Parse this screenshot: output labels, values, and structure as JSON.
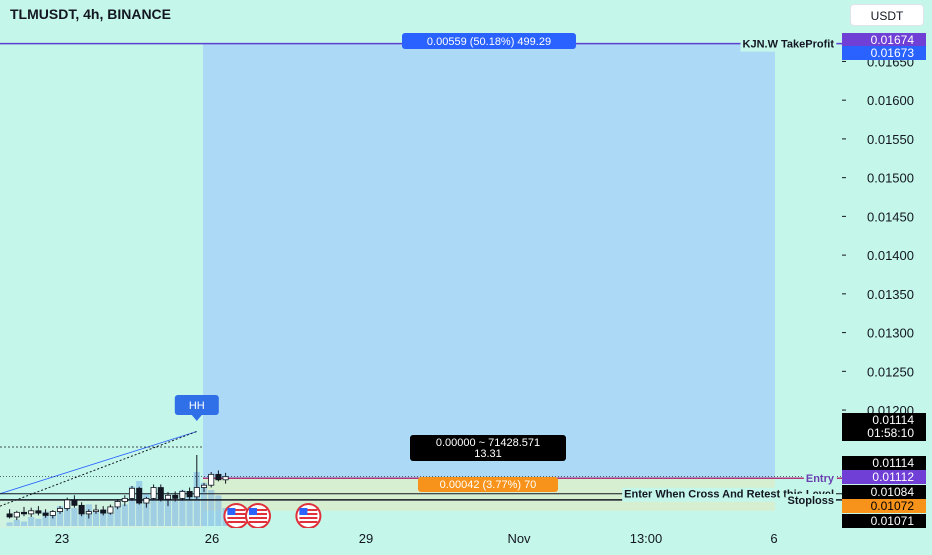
{
  "header": {
    "symbol_title": "TLMUSDT, 4h, BINANCE",
    "currency": "USDT"
  },
  "colors": {
    "background": "#c4f6ea",
    "profit_zone": "#acdaf6",
    "loss_zone": "#d6efd0",
    "bullish_candle": "#ffffff",
    "bearish_candle": "#131722",
    "take_profit_line": "#5b3fd0",
    "entry_line": "#b0357a",
    "hh_marker": "#2f6fe8",
    "stoploss_label": "#f7931a",
    "volume": "#7ab1e8"
  },
  "chart_data": {
    "type": "candlestick",
    "symbol": "TLMUSDT",
    "interval": "4h",
    "exchange": "BINANCE",
    "y_axis": {
      "unit": "USDT",
      "range": [
        0.01071,
        0.01688
      ],
      "ticks": [
        "0.01650",
        "0.01600",
        "0.01550",
        "0.01500",
        "0.01450",
        "0.01400",
        "0.01350",
        "0.01300",
        "0.01250",
        "0.01200"
      ]
    },
    "x_axis": {
      "ticks": [
        "23",
        "26",
        "29",
        "Nov",
        "13:00",
        "6"
      ]
    },
    "price_badges": [
      {
        "text": "0.01674",
        "price": 0.01674,
        "bg": "#6f3fd6",
        "fg": "#ffffff"
      },
      {
        "text": "0.01673",
        "price": 0.01673,
        "bg": "#2962ff",
        "fg": "#ffffff"
      },
      {
        "text": "0.01114",
        "text2": "01:58:10",
        "price": 0.01114,
        "bg": "#000000",
        "fg": "#ffffff"
      },
      {
        "text": "0.01114",
        "price": 0.01114,
        "bg": "#000000",
        "fg": "#ffffff"
      },
      {
        "text": "0.01112",
        "price": 0.01112,
        "bg": "#6f3fd6",
        "fg": "#ffffff"
      },
      {
        "text": "0.01084",
        "price": 0.01084,
        "bg": "#000000",
        "fg": "#ffffff"
      },
      {
        "text": "0.01072",
        "price": 0.01072,
        "bg": "#f7931a",
        "fg": "#000000"
      },
      {
        "text": "0.01071",
        "price": 0.01071,
        "bg": "#000000",
        "fg": "#ffffff"
      }
    ],
    "levels": [
      {
        "name": "KJN.W TakeProfit",
        "price": 0.01673
      },
      {
        "name": "Entry",
        "price": 0.01112
      },
      {
        "name": "Enter When Cross And Retest this Level",
        "price": 0.01092
      },
      {
        "name": "Stoploss",
        "price": 0.01084
      }
    ],
    "position": {
      "profit_label": "0.00559 (50.18%) 499.29",
      "center_label": "0.00000 ~ 71428.571",
      "center_label_2": "13.31",
      "loss_label": "0.00042 (3.77%) 70",
      "entry": 0.01112,
      "take_profit": 0.01673,
      "stop": 0.0107
    },
    "annotation": {
      "text": "HH",
      "price": 0.01144
    },
    "candles": [
      {
        "o": 0.01066,
        "h": 0.01072,
        "l": 0.0106,
        "c": 0.01062
      },
      {
        "o": 0.01062,
        "h": 0.0107,
        "l": 0.01058,
        "c": 0.01068
      },
      {
        "o": 0.01068,
        "h": 0.01075,
        "l": 0.01063,
        "c": 0.01066
      },
      {
        "o": 0.01066,
        "h": 0.01074,
        "l": 0.01062,
        "c": 0.0107
      },
      {
        "o": 0.0107,
        "h": 0.01076,
        "l": 0.01064,
        "c": 0.01067
      },
      {
        "o": 0.01067,
        "h": 0.01072,
        "l": 0.01061,
        "c": 0.01064
      },
      {
        "o": 0.01064,
        "h": 0.01071,
        "l": 0.0106,
        "c": 0.01069
      },
      {
        "o": 0.01069,
        "h": 0.01076,
        "l": 0.01066,
        "c": 0.01073
      },
      {
        "o": 0.01073,
        "h": 0.01087,
        "l": 0.0107,
        "c": 0.01084
      },
      {
        "o": 0.01084,
        "h": 0.0109,
        "l": 0.01074,
        "c": 0.01077
      },
      {
        "o": 0.01077,
        "h": 0.01081,
        "l": 0.01063,
        "c": 0.01066
      },
      {
        "o": 0.01066,
        "h": 0.01072,
        "l": 0.0106,
        "c": 0.01069
      },
      {
        "o": 0.01069,
        "h": 0.01078,
        "l": 0.01066,
        "c": 0.01071
      },
      {
        "o": 0.01071,
        "h": 0.01076,
        "l": 0.01064,
        "c": 0.01067
      },
      {
        "o": 0.01067,
        "h": 0.01078,
        "l": 0.01065,
        "c": 0.01075
      },
      {
        "o": 0.01075,
        "h": 0.01085,
        "l": 0.01072,
        "c": 0.01082
      },
      {
        "o": 0.01082,
        "h": 0.0109,
        "l": 0.01076,
        "c": 0.01086
      },
      {
        "o": 0.01086,
        "h": 0.01102,
        "l": 0.01083,
        "c": 0.01099
      },
      {
        "o": 0.01099,
        "h": 0.01101,
        "l": 0.01078,
        "c": 0.0108
      },
      {
        "o": 0.0108,
        "h": 0.01088,
        "l": 0.01074,
        "c": 0.01086
      },
      {
        "o": 0.01086,
        "h": 0.01104,
        "l": 0.01084,
        "c": 0.011
      },
      {
        "o": 0.011,
        "h": 0.01104,
        "l": 0.01082,
        "c": 0.01085
      },
      {
        "o": 0.01085,
        "h": 0.01094,
        "l": 0.01076,
        "c": 0.0109
      },
      {
        "o": 0.0109,
        "h": 0.01095,
        "l": 0.01082,
        "c": 0.01086
      },
      {
        "o": 0.01086,
        "h": 0.01097,
        "l": 0.01083,
        "c": 0.01095
      },
      {
        "o": 0.01095,
        "h": 0.011,
        "l": 0.01084,
        "c": 0.01088
      },
      {
        "o": 0.01088,
        "h": 0.01142,
        "l": 0.01085,
        "c": 0.011
      },
      {
        "o": 0.011,
        "h": 0.01106,
        "l": 0.01094,
        "c": 0.01103
      },
      {
        "o": 0.01103,
        "h": 0.0112,
        "l": 0.011,
        "c": 0.01117
      },
      {
        "o": 0.01117,
        "h": 0.01122,
        "l": 0.01108,
        "c": 0.0111
      },
      {
        "o": 0.0111,
        "h": 0.01119,
        "l": 0.01105,
        "c": 0.01114
      }
    ],
    "volumes": [
      0.04,
      0.07,
      0.05,
      0.1,
      0.08,
      0.16,
      0.12,
      0.22,
      0.26,
      0.2,
      0.18,
      0.24,
      0.16,
      0.18,
      0.2,
      0.28,
      0.24,
      0.44,
      0.5,
      0.36,
      0.4,
      0.32,
      0.3,
      0.28,
      0.4,
      0.36,
      0.6,
      0.48,
      0.4,
      0.34,
      0.2
    ],
    "event_markers": [
      {
        "name": "us-flag-icon",
        "time_index": 31.5
      },
      {
        "name": "us-flag-icon",
        "time_index": 34.5
      },
      {
        "name": "us-flag-icon",
        "time_index": 41.5
      }
    ]
  }
}
